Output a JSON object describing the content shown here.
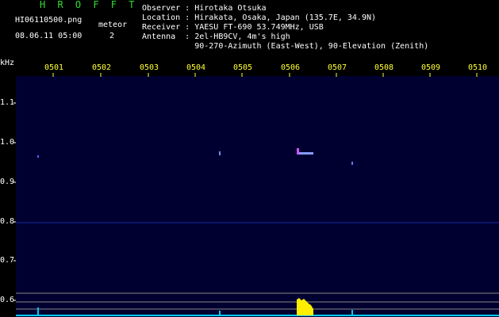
{
  "header": {
    "logo": "H R O F F T",
    "filename": "HI06110500.png",
    "datetime": "08.06.11 05:00",
    "meteor_label": "meteor",
    "meteor_count": "2",
    "observer": "Observer : Hirotaka Otsuka",
    "location": "Location : Hirakata, Osaka, Japan (135.7E, 34.9N)",
    "receiver": "Receiver : YAESU FT-690 53.749MHz, USB",
    "antenna": "Antenna  : 2el-HB9CV, 4m's high",
    "antenna2": "           90-270-Azimuth (East-West), 90-Elevation (Zenith)"
  },
  "axis": {
    "unit": "kHz",
    "time_ticks": [
      "0501",
      "0502",
      "0503",
      "0504",
      "0505",
      "0506",
      "0507",
      "0508",
      "0509",
      "0510"
    ],
    "freq_ticks": [
      "1.1",
      "1.0",
      "0.9",
      "0.8",
      "0.7",
      "0.6"
    ]
  },
  "colors": {
    "background": "#000000",
    "plot_bg": "#000030",
    "time_label": "#ffff33",
    "logo": "#33dd33",
    "baseline": "#00ccff",
    "signal": "#ffee00"
  }
}
